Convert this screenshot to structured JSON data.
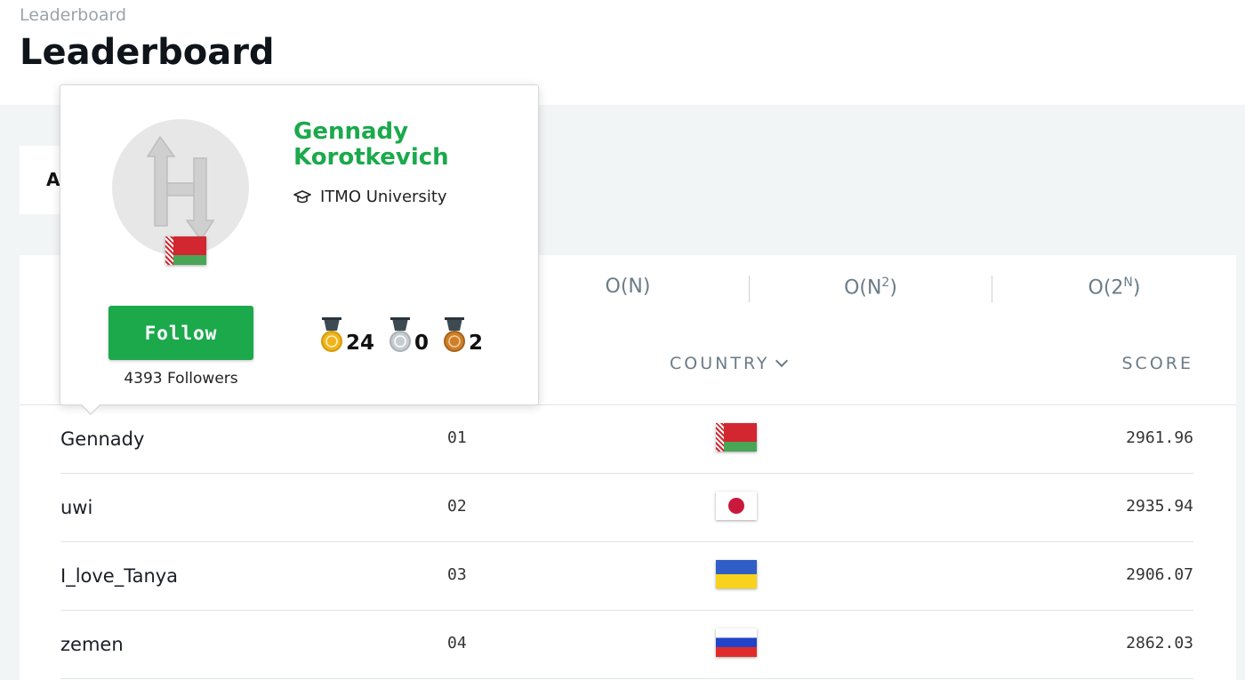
{
  "breadcrumb": "Leaderboard",
  "page_title": "Leaderboard",
  "filter_letter": "A",
  "tabs": [
    {
      "base": "O(N)",
      "sup": ""
    },
    {
      "base": "O(N",
      "sup": "2",
      "tail": ")"
    },
    {
      "base": "O(2",
      "sup": "N",
      "tail": ")"
    }
  ],
  "table": {
    "columns": {
      "country": "COUNTRY",
      "score": "SCORE"
    },
    "rows": [
      {
        "name": "Gennady",
        "rank": "01",
        "flag": "belarus",
        "score": "2961.96"
      },
      {
        "name": "uwi",
        "rank": "02",
        "flag": "japan",
        "score": "2935.94"
      },
      {
        "name": "I_love_Tanya",
        "rank": "03",
        "flag": "ukraine",
        "score": "2906.07"
      },
      {
        "name": "zemen",
        "rank": "04",
        "flag": "russia",
        "score": "2862.03"
      }
    ]
  },
  "profile": {
    "name": "Gennady Korotkevich",
    "school": "ITMO University",
    "school_icon": "graduation-cap-icon",
    "flag": "belarus",
    "follow_label": "Follow",
    "followers": "4393 Followers",
    "medals": {
      "gold": "24",
      "silver": "0",
      "bronze": "2"
    }
  },
  "colors": {
    "accent": "#1ba94c",
    "gold": "#f0b41c",
    "silver": "#c7ccd1",
    "bronze": "#cd7f2a"
  }
}
